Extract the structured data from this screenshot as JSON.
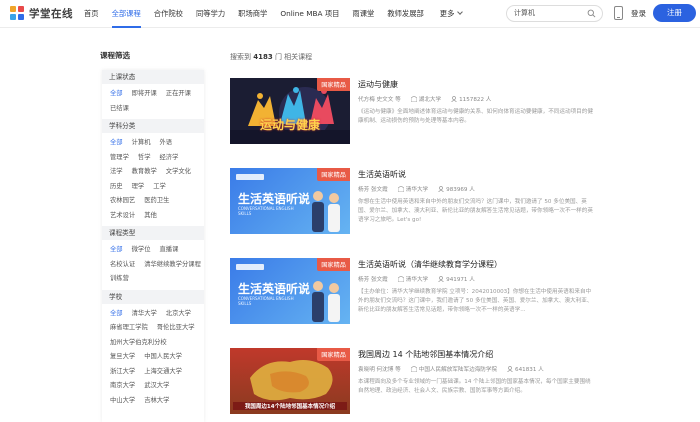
{
  "brand": {
    "name": "学堂在线"
  },
  "nav": {
    "items": [
      "首页",
      "全部课程",
      "合作院校",
      "同等学力",
      "职场商学",
      "Online MBA 项目",
      "雨课堂",
      "教师发展部"
    ],
    "more": "更多"
  },
  "search": {
    "value": "计算机"
  },
  "header_actions": {
    "login": "登录",
    "register": "注册"
  },
  "filters": {
    "title": "课程筛选",
    "groups": [
      {
        "label": "上课状态",
        "options": [
          "全部",
          "即将开课",
          "正在开课",
          "已结课"
        ]
      },
      {
        "label": "学科分类",
        "options": [
          "全部",
          "计算机",
          "外语",
          "管理学",
          "哲学",
          "经济学",
          "法学",
          "教育教学",
          "文学文化",
          "历史",
          "理学",
          "工学",
          "农林园艺",
          "医药卫生",
          "艺术设计",
          "其他"
        ]
      },
      {
        "label": "课程类型",
        "options": [
          "全部",
          "微学位",
          "直播课",
          "名校认证",
          "清华继续教学分课程",
          "训练营"
        ]
      },
      {
        "label": "学校",
        "options": [
          "全部",
          "清华大学",
          "北京大学",
          "麻省理工学院",
          "哥伦比亚大学",
          "加州大学伯克利分校",
          "复旦大学",
          "中国人民大学",
          "浙江大学",
          "上海交通大学",
          "南京大学",
          "武汉大学",
          "中山大学",
          "吉林大学"
        ]
      }
    ]
  },
  "results": {
    "count_prefix": "搜索到",
    "count": "4183",
    "count_suffix": "门 相关课程"
  },
  "courses": [
    {
      "title": "运动与健康",
      "badge": "国家精品",
      "teacher": "代方梅 史文文 等",
      "school": "湖北大学",
      "students": "1157822 人",
      "thumb_text": "运动与健康",
      "desc": "《运动与健康》全面地阐述体育运动与健康的关系、如何向体育运动要健康，不同运动项目的健康机制、运动损伤的预防与处理等基本内容。"
    },
    {
      "title": "生活英语听说",
      "badge": "国家精品",
      "teacher": "杨芳 张文霞",
      "school": "清华大学",
      "students": "983969 人",
      "thumb_text": "生活英语听说",
      "thumb_sub": "CONVERSATIONAL ENGLISH SKILLS",
      "desc": "你想在生活中使用英语和来自中外的朋友们交流吗？这门课中，我们邀请了 50 多位美国、英国、爱尔兰、加拿大、澳大利亚、新伦比亚的朋友解答生活常见话题，带你领略一次不一样的英语学习之旅吧。Let's go!"
    },
    {
      "title": "生活英语听说（清华继续教育学分课程）",
      "badge": "国家精品",
      "teacher": "杨芳 张文霞",
      "school": "清华大学",
      "students": "941971 人",
      "thumb_text": "生活英语听说",
      "thumb_sub": "CONVERSATIONAL ENGLISH SKILLS",
      "desc": "【主办单位：清华大学继续教育学院 立项号：2042010003】你想在生活中使用英语和来自中外的朋友们交流吗？这门课中，我们邀请了 50 多位美国、英国、爱尔兰、加拿大、澳大利亚、新伦比亚的朋友解答生活常见话题，带你领略一次不一样的英语学..."
    },
    {
      "title": "我国周边 14 个陆地邻国基本情况介绍",
      "badge": "国家精品",
      "teacher": "袁晓明 何沈博 等",
      "school": "中国人民解放军陆军边海防学院",
      "students": "641831 人",
      "thumb_text": "我国周边14个陆地邻国基本情况介绍",
      "desc": "本课程面向及多个专业领域的一门基础课。14 个陆上邻国的国家基本情况，每个国家主要围绕自然地理、政治经济、社会人文、民族宗教、国防军事等方面介绍。"
    }
  ],
  "colors": {
    "accent": "#2f6ce8",
    "register_bg": "#2b62e0",
    "badge": "#e85a46"
  }
}
